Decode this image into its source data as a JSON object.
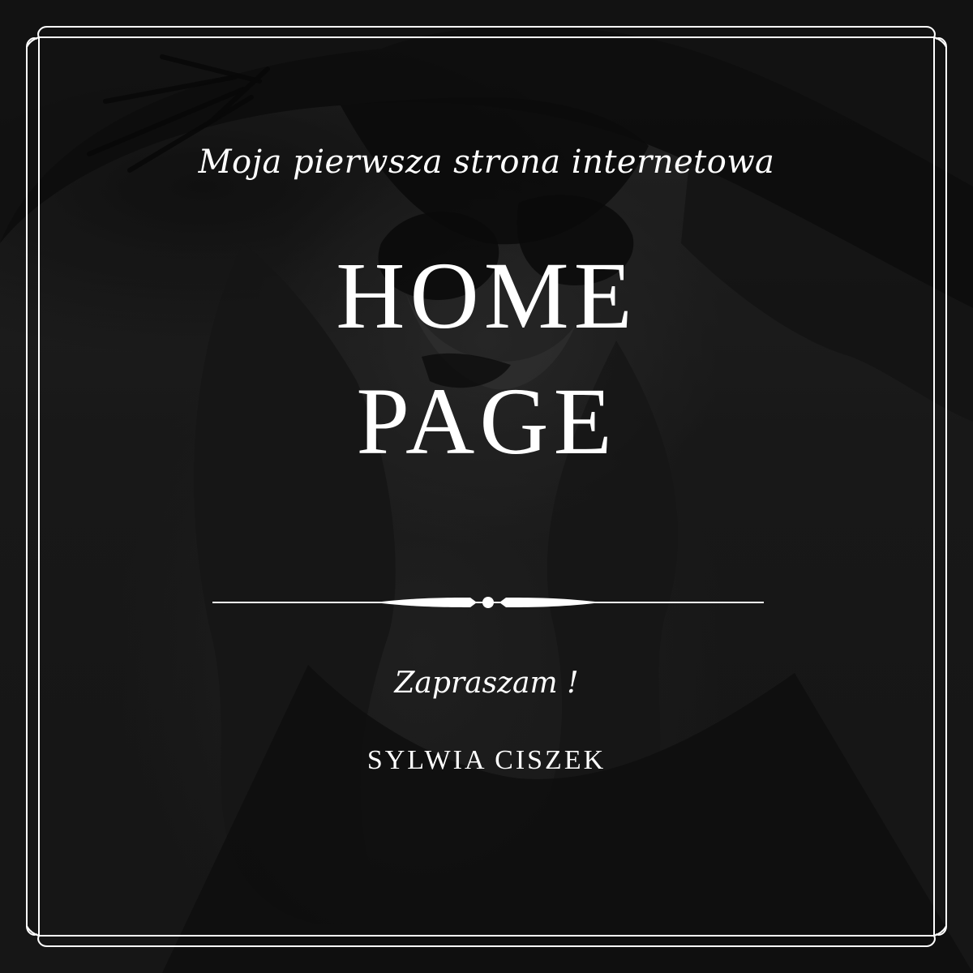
{
  "poster": {
    "subtitle": "Moja pierwsza strona internetowa",
    "title_line_1": "HOME",
    "title_line_2": "PAGE",
    "greeting": "Zapraszam !",
    "author": "SYLWIA CISZEK"
  },
  "colors": {
    "text": "#ffffff",
    "background": "#1e1e1e",
    "frame": "#ffffff"
  },
  "icons": {
    "divider": "ornamental-divider-icon"
  }
}
